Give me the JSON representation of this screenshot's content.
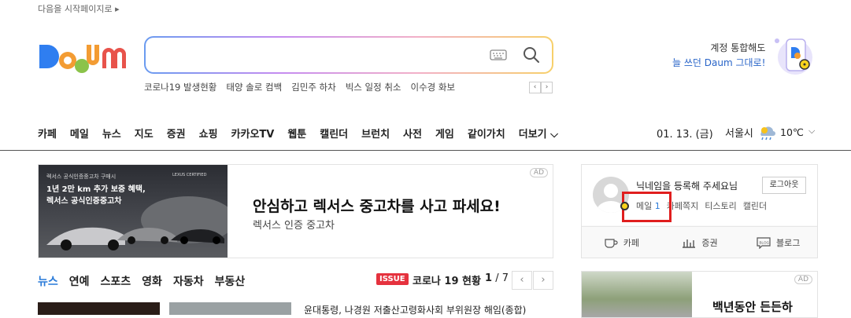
{
  "header": {
    "set_home": "다음을 시작페이지로 ▸",
    "logo_text": "Daum",
    "search_placeholder": "",
    "trends": [
      "코로나19 발생현황",
      "태양 솔로 컴백",
      "김민주 하차",
      "빅스 일정 취소",
      "이수경 화보"
    ],
    "promo_line1": "계정 통합해도",
    "promo_line2": "늘 쓰던 Daum 그대로!"
  },
  "nav": {
    "items": [
      "카페",
      "메일",
      "뉴스",
      "지도",
      "증권",
      "쇼핑",
      "카카오TV",
      "웹툰",
      "캘린더",
      "브런치",
      "사전",
      "게임",
      "같이가치",
      "더보기 ⌵"
    ],
    "date": "01. 13. (금)",
    "city": "서울시",
    "temp": "10℃",
    "chevron": "⌵"
  },
  "ad1": {
    "badge": "AD",
    "img_line0": "렉서스 공식인증중고차 구매시",
    "img_line1": "1년 2만 km 추가 보증 혜택,",
    "img_line2": "렉서스 공식인증중고차",
    "img_brand": "LEXUS CERTIFIED",
    "title": "안심하고 렉서스 중고차를 사고 파세요!",
    "subtitle": "렉서스 인증 중고차"
  },
  "news": {
    "tabs": [
      "뉴스",
      "연예",
      "스포츠",
      "영화",
      "자동차",
      "부동산"
    ],
    "issue_badge": "ISSUE",
    "issue_text": "코로나 19 현황",
    "page_current": "1",
    "page_total": "/ 7",
    "prev": "‹",
    "next": "›",
    "headline": "윤대통령, 나경원 저출산고령화사회 부위원장 해임(종합)"
  },
  "login": {
    "nickname_prompt": "닉네임을 등록해 주세요님",
    "logout": "로그아웃",
    "mail": "메일",
    "mail_count": "1",
    "links": [
      "카페쪽지",
      "티스토리",
      "캘린더"
    ],
    "services": [
      "카페",
      "증권",
      "블로그"
    ],
    "blog_icon_text": "BLOG"
  },
  "ad2": {
    "badge": "AD",
    "title": "백년동안 든든하"
  },
  "colors": {
    "accent_blue": "#2a7ad8",
    "issue_red": "#e5323e",
    "highlight_red": "#e01e1e"
  }
}
